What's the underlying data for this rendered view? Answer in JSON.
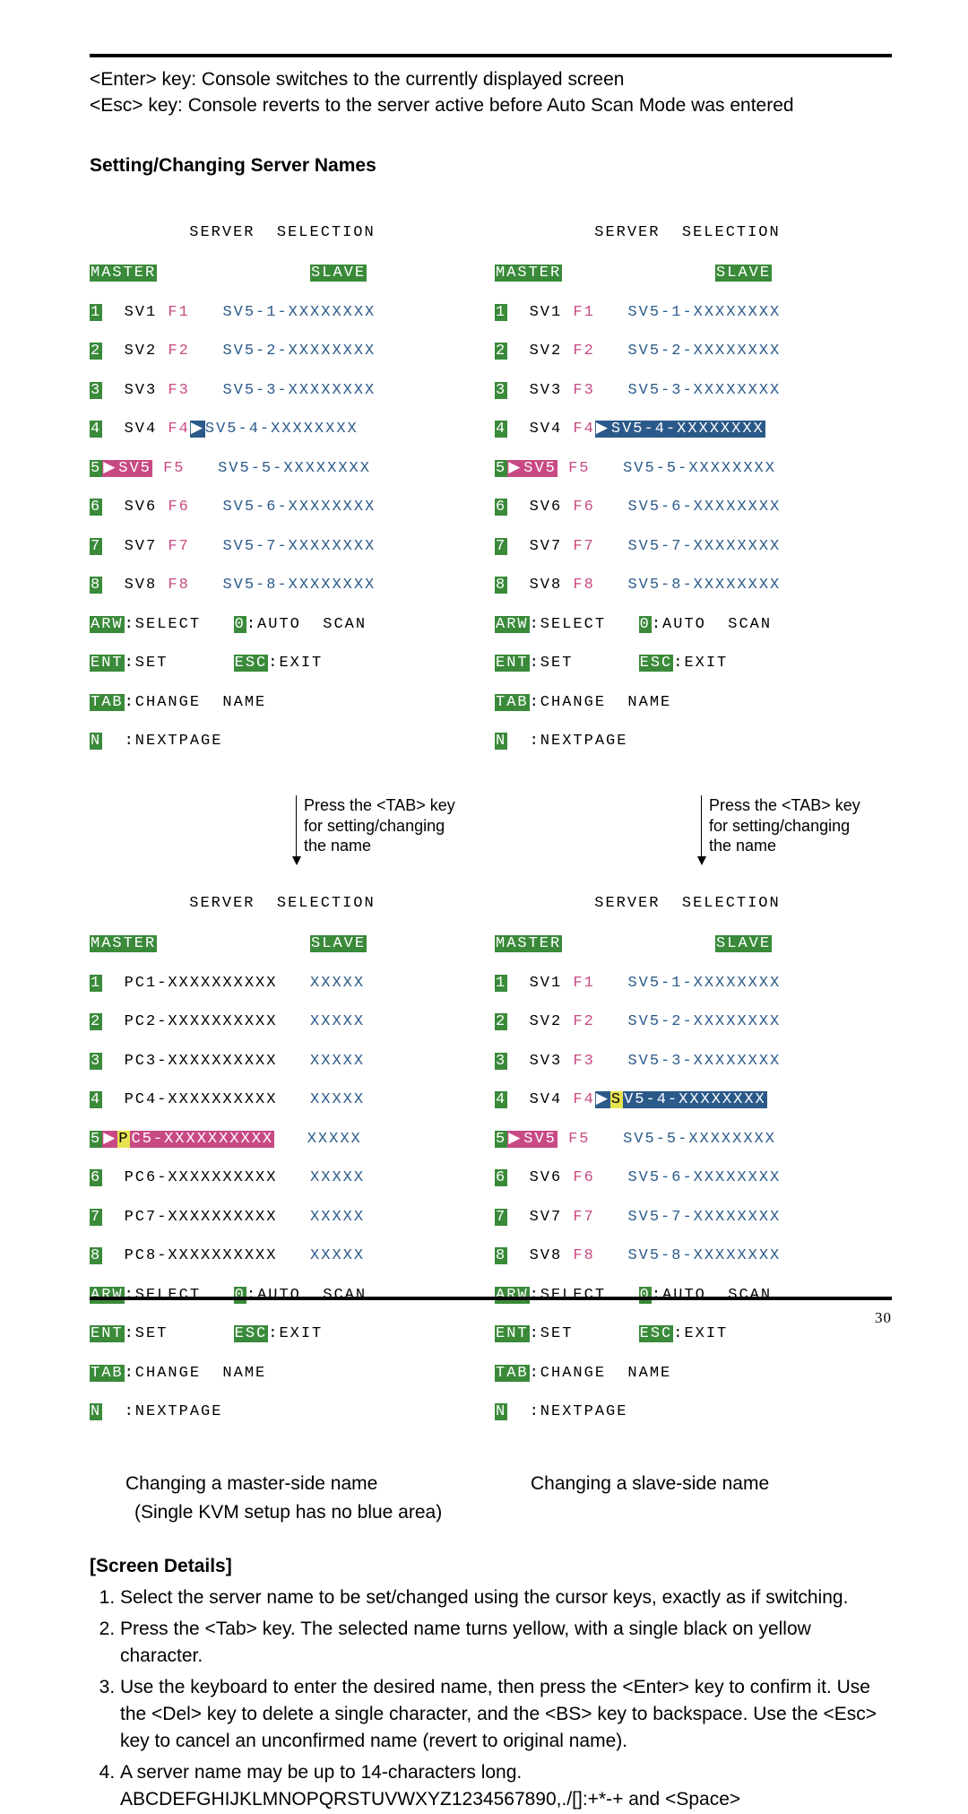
{
  "intro": {
    "l1": "<Enter> key:        Console switches to the currently displayed screen",
    "l2": "<Esc> key: Console reverts to the server active before Auto Scan Mode was entered"
  },
  "subheading": "Setting/Changing Server Names",
  "osd_common": {
    "title": "SERVER  SELECTION",
    "master": "MASTER",
    "slave": "SLAVE",
    "arw": "ARW",
    "arw_v": ":SELECT",
    "zero": "0",
    "zero_v": ":AUTO  SCAN",
    "ent": "ENT",
    "ent_v": ":SET",
    "esc": "ESC",
    "esc_v": ":EXIT",
    "tab": "TAB",
    "tab_v": ":CHANGE  NAME",
    "n": "N",
    "n_v": ":NEXTPAGE"
  },
  "master_rows": [
    {
      "n": "1",
      "m": "SV1",
      "f": "F1",
      "s": "SV5-1-XXXXXXXX"
    },
    {
      "n": "2",
      "m": "SV2",
      "f": "F2",
      "s": "SV5-2-XXXXXXXX"
    },
    {
      "n": "3",
      "m": "SV3",
      "f": "F3",
      "s": "SV5-3-XXXXXXXX"
    },
    {
      "n": "4",
      "m": "SV4",
      "f": "F4",
      "s": "SV5-4-XXXXXXXX"
    },
    {
      "n": "5",
      "m": "SV5",
      "f": "F5",
      "s": "SV5-5-XXXXXXXX"
    },
    {
      "n": "6",
      "m": "SV6",
      "f": "F6",
      "s": "SV5-6-XXXXXXXX"
    },
    {
      "n": "7",
      "m": "SV7",
      "f": "F7",
      "s": "SV5-7-XXXXXXXX"
    },
    {
      "n": "8",
      "m": "SV8",
      "f": "F8",
      "s": "SV5-8-XXXXXXXX"
    }
  ],
  "pc_rows": [
    {
      "n": "1",
      "m": "PC1-XXXXXXXXXX",
      "s": "XXXXX"
    },
    {
      "n": "2",
      "m": "PC2-XXXXXXXXXX",
      "s": "XXXXX"
    },
    {
      "n": "3",
      "m": "PC3-XXXXXXXXXX",
      "s": "XXXXX"
    },
    {
      "n": "4",
      "m": "PC4-XXXXXXXXXX",
      "s": "XXXXX"
    },
    {
      "n": "5",
      "m": "PC5-XXXXXXXXXX",
      "s": "XXXXX"
    },
    {
      "n": "6",
      "m": "PC6-XXXXXXXXXX",
      "s": "XXXXX"
    },
    {
      "n": "7",
      "m": "PC7-XXXXXXXXXX",
      "s": "XXXXX"
    },
    {
      "n": "8",
      "m": "PC8-XXXXXXXXXX",
      "s": "XXXXX"
    }
  ],
  "note": {
    "l1": "Press the <TAB> key",
    "l2": "for setting/changing",
    "l3": "the name"
  },
  "captions": {
    "master_l1": "Changing a master-side name",
    "master_l2": "(Single KVM setup has no blue area)",
    "slave": "Changing a slave-side name"
  },
  "details_h": "[Screen Details]",
  "details": [
    "Select the server name to be set/changed using the cursor keys, exactly as if switching.",
    "Press the <Tab> key. The selected name turns yellow, with a single black on yellow character.",
    "Use the keyboard to enter the desired name, then press the <Enter> key to confirm it. Use the <Del> key to delete a single character, and the <BS> key to backspace. Use the <Esc> key to cancel an unconfirmed name (revert to original name).",
    "A server name may be up to 14-characters long. ABCDEFGHIJKLMNOPQRSTUVWXYZ1234567890,./[]:+*-+ and <Space>"
  ],
  "pagenum": "30"
}
